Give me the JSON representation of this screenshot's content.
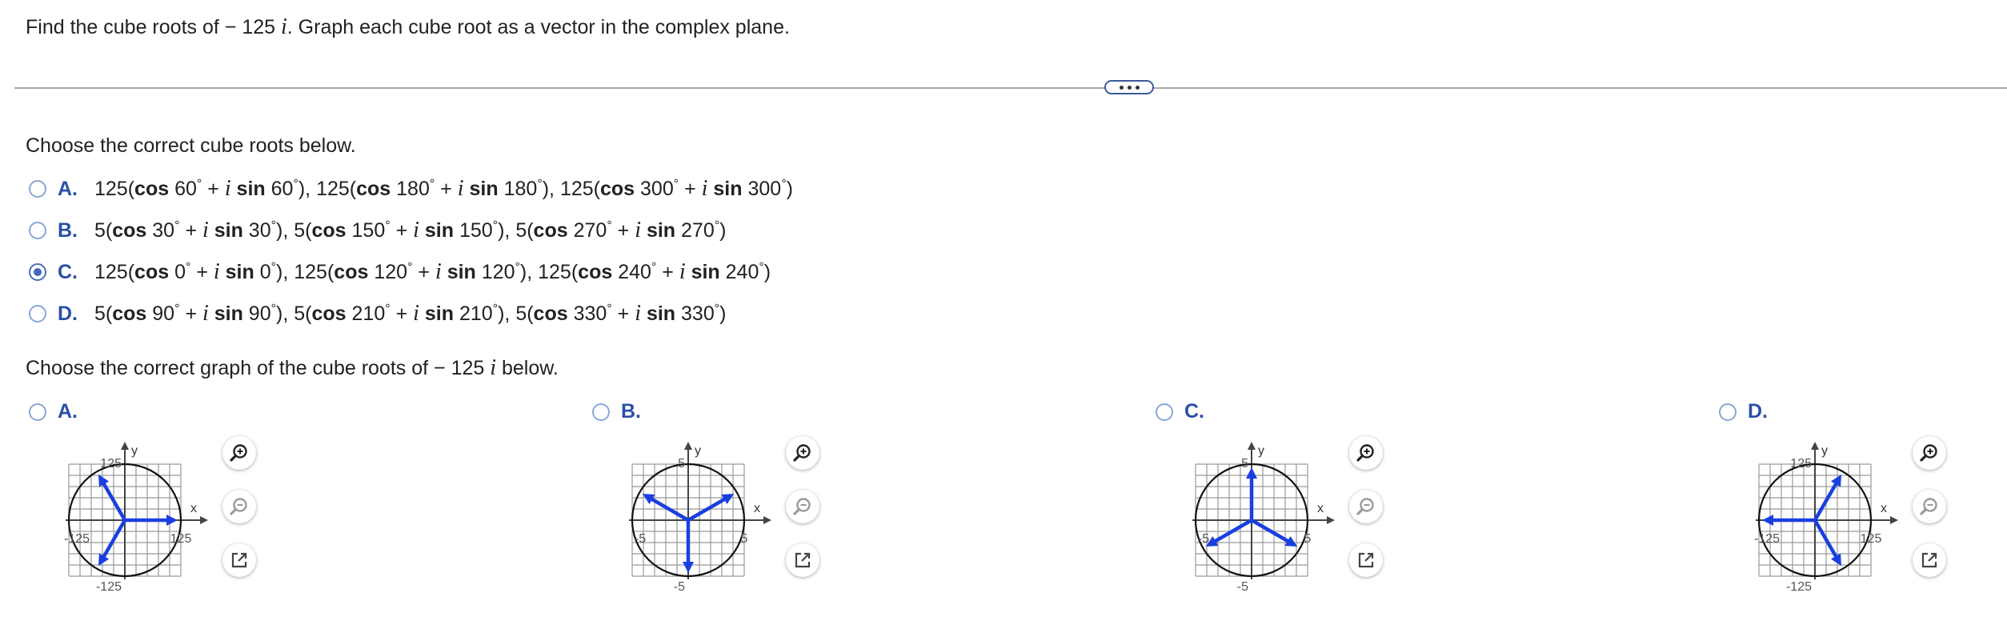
{
  "question": {
    "part1": "Find the cube roots of ",
    "minus": "−",
    "number": " 125",
    "var": "i",
    "part2": ". Graph each cube root as a vector in the complex plane."
  },
  "more_button": {
    "icon": "ellipsis-icon"
  },
  "roots_prompt": "Choose the correct cube roots below.",
  "root_options": [
    {
      "letter": "A.",
      "selected": false,
      "terms": [
        {
          "mod": "125",
          "angle": "60"
        },
        {
          "mod": "125",
          "angle": "180"
        },
        {
          "mod": "125",
          "angle": "300"
        }
      ]
    },
    {
      "letter": "B.",
      "selected": false,
      "terms": [
        {
          "mod": "5",
          "angle": "30"
        },
        {
          "mod": "5",
          "angle": "150"
        },
        {
          "mod": "5",
          "angle": "270"
        }
      ]
    },
    {
      "letter": "C.",
      "selected": true,
      "terms": [
        {
          "mod": "125",
          "angle": "0"
        },
        {
          "mod": "125",
          "angle": "120"
        },
        {
          "mod": "125",
          "angle": "240"
        }
      ]
    },
    {
      "letter": "D.",
      "selected": false,
      "terms": [
        {
          "mod": "5",
          "angle": "90"
        },
        {
          "mod": "5",
          "angle": "210"
        },
        {
          "mod": "5",
          "angle": "330"
        }
      ]
    }
  ],
  "math_words": {
    "cos": "cos",
    "sin": "sin",
    "i": "i",
    "deg": "°",
    "plus": "+"
  },
  "graph_prompt": {
    "part1": "Choose the correct graph of the cube roots of ",
    "minus": "−",
    "number": " 125",
    "var": "i",
    "part2": " below."
  },
  "graph_options": [
    {
      "letter": "A.",
      "selected": false,
      "tick_pos": "125",
      "tick_neg": "-125",
      "vectors_deg": [
        0,
        120,
        240
      ]
    },
    {
      "letter": "B.",
      "selected": false,
      "tick_pos": "5",
      "tick_neg": "-5",
      "vectors_deg": [
        30,
        150,
        270
      ]
    },
    {
      "letter": "C.",
      "selected": false,
      "tick_pos": "5",
      "tick_neg": "-5",
      "vectors_deg": [
        90,
        210,
        330
      ]
    },
    {
      "letter": "D.",
      "selected": false,
      "tick_pos": "125",
      "tick_neg": "-125",
      "vectors_deg": [
        60,
        180,
        300
      ]
    }
  ],
  "axis_labels": {
    "x": "x",
    "y": "y"
  },
  "tools": [
    "zoom-in-icon",
    "zoom-out-icon",
    "open-new-window-icon"
  ],
  "colors": {
    "vector": "#1a3fe0",
    "accent": "#2b4fa8",
    "radio": "#4169b8"
  }
}
